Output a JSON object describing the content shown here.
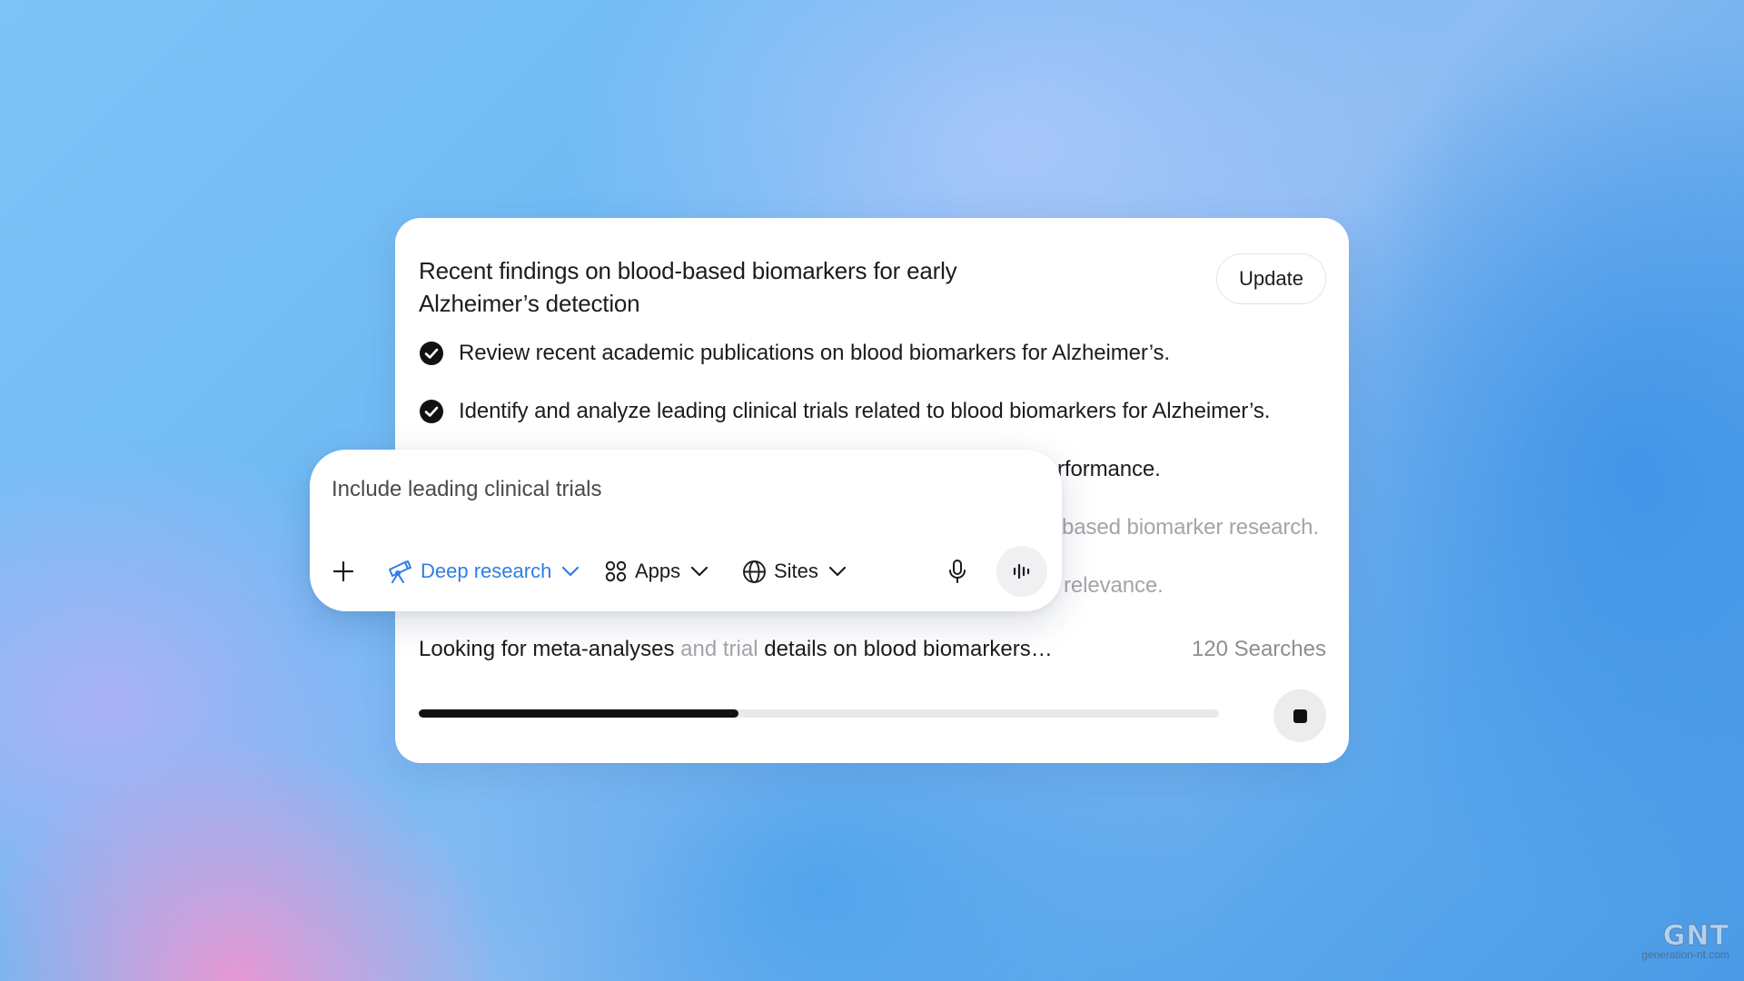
{
  "research_card": {
    "title": "Recent findings on blood-based biomarkers for early Alzheimer’s detection",
    "update_label": "Update",
    "steps": [
      {
        "text": "Review recent academic publications on blood biomarkers for Alzheimer’s.",
        "status": "done"
      },
      {
        "text": "Identify and analyze leading clinical trials related to blood biomarkers for Alzheimer’s.",
        "status": "done"
      },
      {
        "text": "rformance.",
        "status": "obscured"
      },
      {
        "text": "based biomarker research.",
        "status": "obscured"
      },
      {
        "text": "relevance.",
        "status": "obscured"
      }
    ],
    "status": {
      "text_part1": "Looking for meta-analyses",
      "text_part2": "and trial",
      "text_part3": "details on blood biomarkers…",
      "search_count": "120 Searches"
    },
    "progress": 0.4
  },
  "composer": {
    "input_value": "Include leading clinical trials",
    "mode_label": "Deep research",
    "apps_label": "Apps",
    "sites_label": "Sites"
  },
  "icons": {
    "step_done": "check-circle-icon",
    "add": "plus-icon",
    "mode": "telescope-icon",
    "apps": "apps-grid-icon",
    "sites": "globe-icon",
    "mic": "microphone-icon",
    "voice": "voice-wave-icon",
    "stop": "stop-icon"
  },
  "colors": {
    "accent": "#2f7ee6",
    "progress_fill": "#111111",
    "progress_track": "#e9e9ec",
    "muted_text": "#a4a4aa"
  },
  "watermark": {
    "logo": "GNT",
    "site": "generation-nt.com"
  }
}
